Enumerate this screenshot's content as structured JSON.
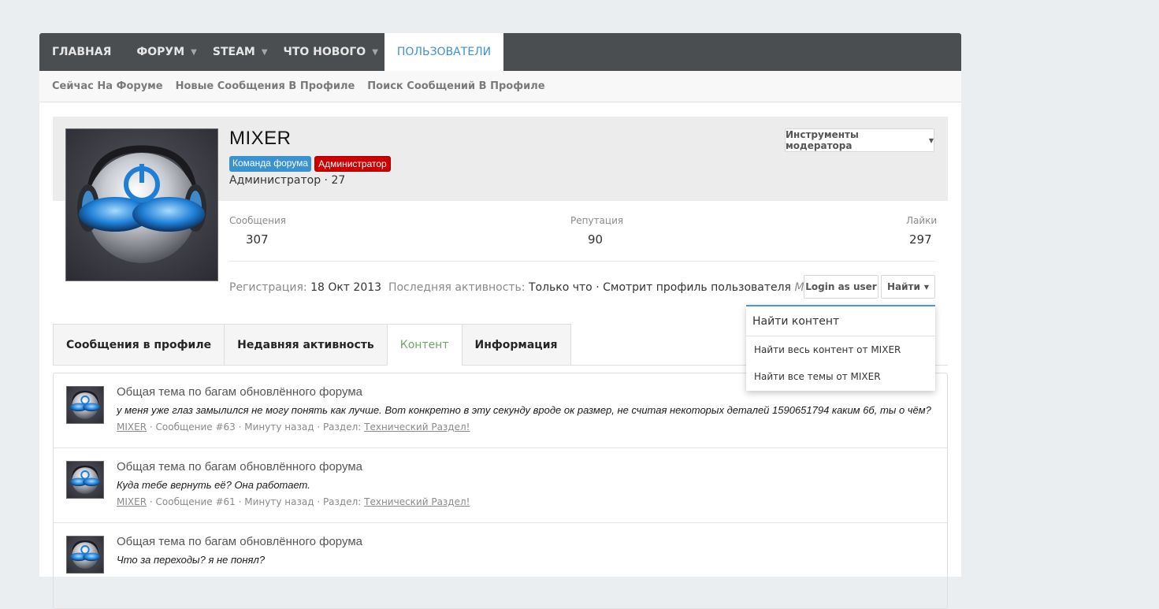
{
  "nav": {
    "tabs": [
      {
        "label": "ГЛАВНАЯ"
      },
      {
        "label": "ФОРУМ"
      },
      {
        "label": "STEAM"
      },
      {
        "label": "ЧТО НОВОГО"
      },
      {
        "label": "ПОЛЬЗОВАТЕЛИ"
      }
    ],
    "selected_index": 4
  },
  "subnav": {
    "items": [
      "Сейчас На Форуме",
      "Новые Сообщения В Профиле",
      "Поиск Сообщений В Профиле"
    ]
  },
  "profile": {
    "username": "MIXER",
    "badges": [
      {
        "label": "Команда форума",
        "color": "#3b92d1"
      },
      {
        "label": "Администратор",
        "color": "#cc0000"
      }
    ],
    "title_line": "Администратор · 27",
    "moderator_tools": "Инструменты модератора",
    "stats": {
      "messages_label": "Сообщения",
      "messages_value": "307",
      "reputation_label": "Репутация",
      "reputation_value": "90",
      "likes_label": "Лайки",
      "likes_value": "297"
    },
    "registration_label": "Регистрация:",
    "registration_value": "18 Окт 2013",
    "last_activity_label": "Последняя активность:",
    "last_activity_value": "Только что",
    "activity_text": "· Смотрит профиль пользователя",
    "activity_user": "MIXER",
    "login_as_button": "Login as user",
    "find_button": "Найти"
  },
  "dropdown": {
    "title": "Найти контент",
    "items": [
      "Найти весь контент от MIXER",
      "Найти все темы от MIXER"
    ]
  },
  "tabs": {
    "items": [
      "Сообщения в профиле",
      "Недавняя активность",
      "Контент",
      "Информация"
    ],
    "active_index": 2
  },
  "posts": [
    {
      "title": "Общая тема по багам обновлённого форума",
      "snippet": "у меня уже глаз замылился не могу понять как лучше. Вот конкретно в эту секунду вроде ок размер, не считая некоторых деталей 1590651794 каким 6б, ты о чём?",
      "author": "MIXER",
      "meta": "· Сообщение #63 · Минуту назад · Раздел:",
      "section": "Технический Раздел!"
    },
    {
      "title": "Общая тема по багам обновлённого форума",
      "snippet": "Куда тебе вернуть её? Она работает.",
      "author": "MIXER",
      "meta": "· Сообщение #61 · Минуту назад · Раздел:",
      "section": "Технический Раздел!"
    },
    {
      "title": "Общая тема по багам обновлённого форума",
      "snippet": "Что за переходы? я не понял?",
      "author": "",
      "meta": "",
      "section": ""
    }
  ],
  "colors": {
    "navbar": "#4a4e51",
    "accent_blue": "#3d8fd8",
    "active_tab_green": "#73a26c",
    "page_bg": "#ebeef1"
  }
}
